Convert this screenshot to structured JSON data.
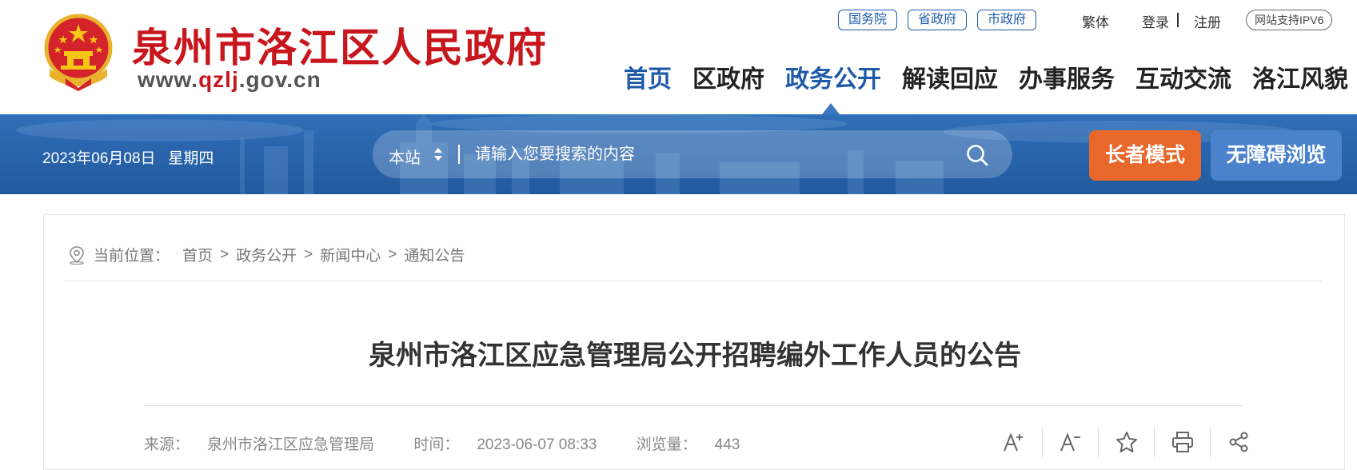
{
  "header": {
    "title": "泉州市洛江区人民政府",
    "url_prefix": "www.",
    "url_highlight": "qzlj",
    "url_suffix": ".gov.cn",
    "top_links": [
      "国务院",
      "省政府",
      "市政府"
    ],
    "traditional": "繁体",
    "login": "登录",
    "register": "注册",
    "ipv6": "网站支持IPV6",
    "nav": [
      "首页",
      "区政府",
      "政务公开",
      "解读回应",
      "办事服务",
      "互动交流",
      "洛江风貌"
    ],
    "active_nav": "政务公开"
  },
  "bluebar": {
    "date": "2023年06月08日",
    "weekday": "星期四",
    "search_scope": "本站",
    "search_placeholder": "请输入您要搜索的内容",
    "elder_mode": "长者模式",
    "accessible": "无障碍浏览"
  },
  "breadcrumb": {
    "prefix": "当前位置：",
    "items": [
      "首页",
      "政务公开",
      "新闻中心",
      "通知公告"
    ],
    "separator": ">"
  },
  "article": {
    "title": "泉州市洛江区应急管理局公开招聘编外工作人员的公告",
    "source_label": "来源：",
    "source": "泉州市洛江区应急管理局",
    "time_label": "时间：",
    "time": "2023-06-07 08:33",
    "views_label": "浏览量：",
    "views": "443"
  },
  "colors": {
    "brand_red": "#c8161d",
    "brand_blue": "#1e5aa8",
    "elder_orange": "#e8672a",
    "access_blue": "#4b82cc"
  }
}
